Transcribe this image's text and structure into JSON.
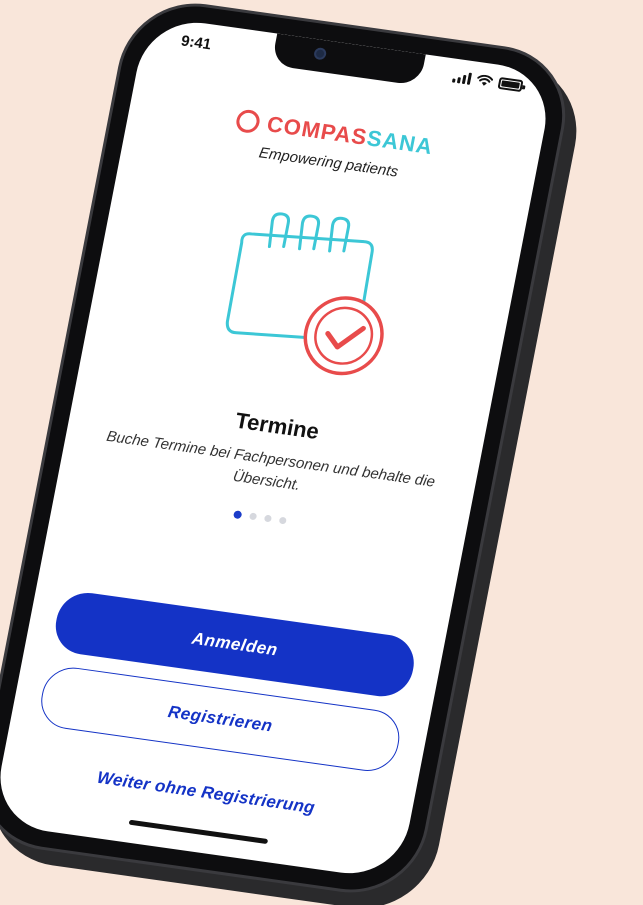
{
  "status_bar": {
    "time": "9:41"
  },
  "brand": {
    "name_part1": "COMPAS",
    "name_part2": "SANA",
    "tagline": "Empowering patients",
    "color_primary": "#e84b4b",
    "color_secondary": "#3cc7d6"
  },
  "onboarding": {
    "illustration": "calendar-check-icon",
    "title": "Termine",
    "description": "Buche Termine bei Fachpersonen und behalte die Übersicht.",
    "page_count": 4,
    "active_page": 1
  },
  "actions": {
    "login_label": "Anmelden",
    "register_label": "Registrieren",
    "skip_label": "Weiter ohne Registrierung"
  },
  "colors": {
    "accent": "#1433c6",
    "background": "#f9e6da"
  }
}
